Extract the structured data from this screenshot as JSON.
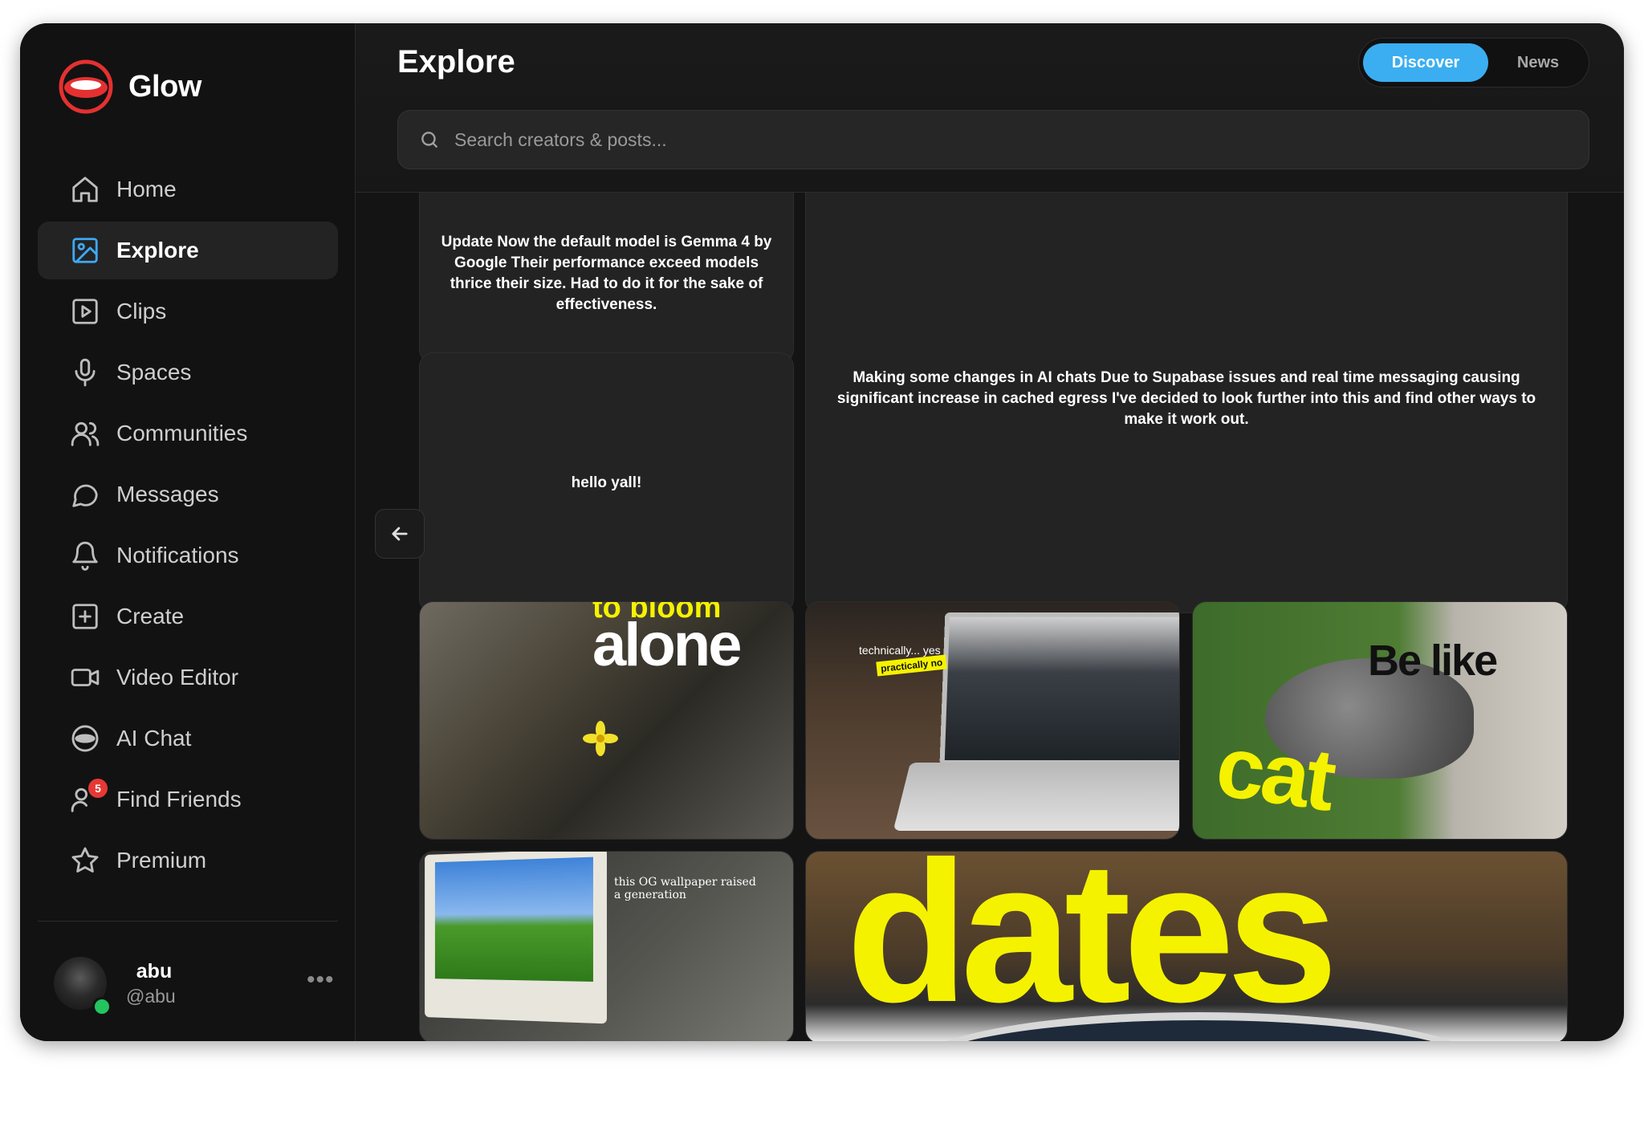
{
  "app": {
    "name": "Glow"
  },
  "sidebar": {
    "items": [
      {
        "label": "Home",
        "icon": "home-icon",
        "active": false
      },
      {
        "label": "Explore",
        "icon": "image-icon",
        "active": true
      },
      {
        "label": "Clips",
        "icon": "play-square-icon",
        "active": false
      },
      {
        "label": "Spaces",
        "icon": "microphone-icon",
        "active": false
      },
      {
        "label": "Communities",
        "icon": "users-icon",
        "active": false
      },
      {
        "label": "Messages",
        "icon": "chat-bubble-icon",
        "active": false
      },
      {
        "label": "Notifications",
        "icon": "bell-icon",
        "active": false
      },
      {
        "label": "Create",
        "icon": "plus-square-icon",
        "active": false
      },
      {
        "label": "Video Editor",
        "icon": "video-camera-icon",
        "active": false
      },
      {
        "label": "AI Chat",
        "icon": "ai-chat-icon",
        "active": false
      },
      {
        "label": "Find Friends",
        "icon": "user-search-icon",
        "active": false,
        "badge": "5"
      },
      {
        "label": "Premium",
        "icon": "star-icon",
        "active": false
      }
    ],
    "profile": {
      "name": "abu",
      "handle": "@abu",
      "more": "•••",
      "status": "online"
    }
  },
  "header": {
    "title": "Explore",
    "tabs": [
      {
        "label": "Discover",
        "active": true
      },
      {
        "label": "News",
        "active": false
      }
    ],
    "search": {
      "placeholder": "Search creators & posts...",
      "value": ""
    }
  },
  "posts": {
    "gemma_update": "Update Now the default model is Gemma 4 by Google Their performance exceed models thrice their size. Had to do it for the sake of effectiveness.",
    "ai_chats": "Making some changes in AI chats Due to Supabase issues and real time messaging causing significant increase in cached egress I've decided to look further into this and find other ways to make it work out.",
    "hello": "hello yall!",
    "media": [
      {
        "caption": "alone",
        "caption_top": "to bloom",
        "theme": "flower"
      },
      {
        "caption": "technically... yes",
        "caption_tag": "practically no",
        "theme": "laptop"
      },
      {
        "caption": "Be like",
        "caption_big": "cat",
        "theme": "cat"
      },
      {
        "caption": "this OG wallpaper raised a generation",
        "theme": "xp"
      },
      {
        "caption": "dates",
        "theme": "dates"
      }
    ]
  },
  "colors": {
    "accent": "#3aaef0",
    "badge": "#e53935",
    "online": "#22c55e",
    "highlight_yellow": "#f5f200"
  }
}
